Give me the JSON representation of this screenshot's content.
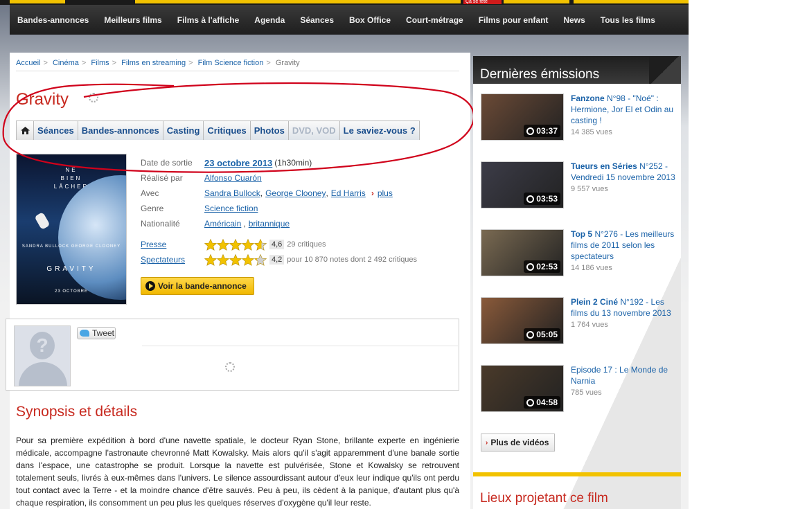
{
  "top_banner": {
    "red_label": "Ça se fête"
  },
  "nav": {
    "items": [
      "Bandes-annonces",
      "Meilleurs films",
      "Films à l'affiche",
      "Agenda",
      "Séances",
      "Box Office",
      "Court-métrage",
      "Films pour enfant",
      "News",
      "Tous les films"
    ]
  },
  "breadcrumb": {
    "items": [
      "Accueil",
      "Cinéma",
      "Films",
      "Films en streaming",
      "Film Science fiction"
    ],
    "current": "Gravity",
    "separator": ">"
  },
  "movie": {
    "title": "Gravity",
    "tabs": [
      "Séances",
      "Bandes-annonces",
      "Casting",
      "Critiques",
      "Photos",
      "DVD, VOD",
      "Le saviez-vous ?"
    ],
    "poster": {
      "tagline_1": "NE",
      "tagline_2": "BIEN",
      "tagline_3": "LÂCHER",
      "actors": "SANDRA BULLOCK  GEORGE CLOONEY",
      "title": "GRAVITY",
      "date": "23 OCTOBRE"
    },
    "release_label": "Date de sortie",
    "release_date": "23 octobre 2013",
    "duration": "(1h30min)",
    "director_label": "Réalisé par",
    "director": "Alfonso Cuarón",
    "cast_label": "Avec",
    "cast": [
      "Sandra Bullock",
      "George Clooney",
      "Ed Harris"
    ],
    "cast_more": "plus",
    "genre_label": "Genre",
    "genre": "Science fiction",
    "nationality_label": "Nationalité",
    "nationality": [
      "Américain",
      "britannique"
    ],
    "press": {
      "label": "Presse",
      "score": "4,6",
      "stars": 4.6,
      "count": "29 critiques"
    },
    "viewers": {
      "label": "Spectateurs",
      "score": "4,2",
      "stars": 4.2,
      "count": "pour 10 870 notes dont 2 492 critiques"
    },
    "trailer_button": "Voir la bande-annonce"
  },
  "social": {
    "tweet_label": "Tweet",
    "avatar_glyph": "?"
  },
  "synopsis": {
    "title": "Synopsis et détails",
    "text": "Pour sa première expédition à bord d'une navette spatiale, le docteur Ryan Stone, brillante experte en ingénierie médicale, accompagne l'astronaute chevronné Matt Kowalsky. Mais alors qu'il s'agit apparemment d'une banale sortie dans l'espace, une catastrophe se produit. Lorsque la navette est pulvérisée, Stone et Kowalsky se retrouvent totalement seuls, livrés à eux-mêmes dans l'univers. Le silence assourdissant autour d'eux leur indique qu'ils ont perdu tout contact avec la Terre - et la moindre chance d'être sauvés. Peu à peu, ils cèdent à la panique, d'autant plus qu'à chaque respiration, ils consomment un peu plus les quelques réserves d'oxygène qu'il leur reste."
  },
  "sidebar": {
    "title": "Dernières émissions",
    "videos": [
      {
        "bold": "Fanzone",
        "text": " N°98 - \"Noé\" : Hermione, Jor El et Odin au casting !",
        "views": "14 385 vues",
        "duration": "03:37",
        "thumb_color": "#6b4a36"
      },
      {
        "bold": "Tueurs en Séries",
        "text": " N°252 - Vendredi 15 novembre 2013",
        "views": "9 557 vues",
        "duration": "03:53",
        "thumb_color": "#3c3c48"
      },
      {
        "bold": "Top 5",
        "text": " N°276 - Les meilleurs films de 2011 selon les spectateurs",
        "views": "14 186 vues",
        "duration": "02:53",
        "thumb_color": "#7a6a52"
      },
      {
        "bold": "Plein 2 Ciné",
        "text": " N°192 - Les films du 13 novembre 2013",
        "views": "1 764 vues",
        "duration": "05:05",
        "thumb_color": "#8a5a3a"
      },
      {
        "bold": "",
        "text": "Episode 17 : Le Monde de Narnia",
        "views": "785 vues",
        "duration": "04:58",
        "thumb_color": "#4a3a2a"
      }
    ],
    "more_videos": "Plus de vidéos",
    "cinemas_title": "Lieux projetant ce film"
  },
  "colors": {
    "title_red": "#c7281e",
    "link_blue": "#1a62a8",
    "accent_yellow": "#f2c200",
    "annotation_red": "#d0021b"
  }
}
